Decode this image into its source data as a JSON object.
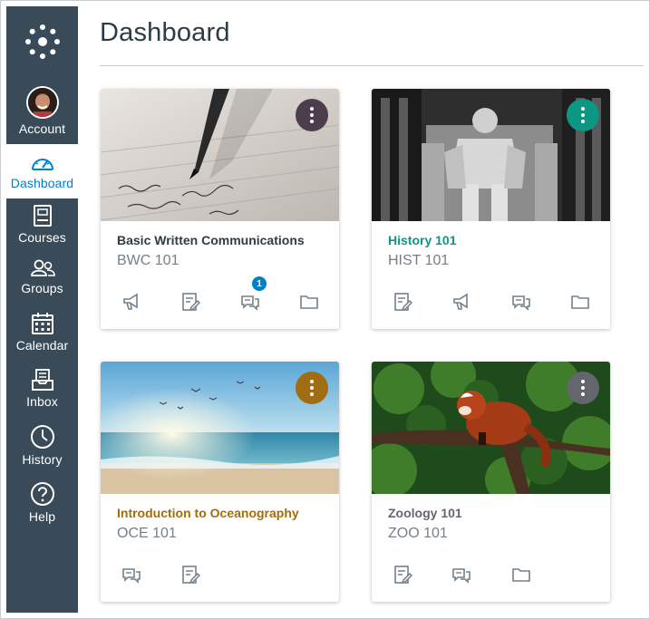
{
  "nav": {
    "items": [
      {
        "label": "Account",
        "icon": "avatar"
      },
      {
        "label": "Dashboard",
        "icon": "dashboard-gauge-icon",
        "active": true
      },
      {
        "label": "Courses",
        "icon": "courses-book-icon"
      },
      {
        "label": "Groups",
        "icon": "groups-icon"
      },
      {
        "label": "Calendar",
        "icon": "calendar-icon"
      },
      {
        "label": "Inbox",
        "icon": "inbox-icon"
      },
      {
        "label": "History",
        "icon": "clock-icon"
      },
      {
        "label": "Help",
        "icon": "help-icon"
      }
    ]
  },
  "page": {
    "title": "Dashboard"
  },
  "cards": [
    {
      "name": "Basic Written Communications",
      "code": "BWC 101",
      "color": "#4d3d4d",
      "name_color": "#2d3b45",
      "actions": [
        "announcements-icon",
        "assignments-icon",
        "discussions-icon",
        "files-icon"
      ],
      "badge": "1"
    },
    {
      "name": "History 101",
      "code": "HIST 101",
      "color": "#0b9784",
      "name_color": "#0b9784",
      "actions": [
        "assignments-icon",
        "announcements-icon",
        "discussions-icon",
        "files-icon"
      ]
    },
    {
      "name": "Introduction to Oceanography",
      "code": "OCE 101",
      "color": "#a16d12",
      "name_color": "#a16d12",
      "actions": [
        "discussions-icon",
        "assignments-icon"
      ]
    },
    {
      "name": "Zoology 101",
      "code": "ZOO 101",
      "color": "#63676c",
      "name_color": "#63676c",
      "actions": [
        "assignments-icon",
        "discussions-icon",
        "files-icon"
      ]
    }
  ],
  "colors": {
    "nav_bg": "#394b58",
    "active": "#0081c6",
    "icon_gray": "#73818c"
  }
}
